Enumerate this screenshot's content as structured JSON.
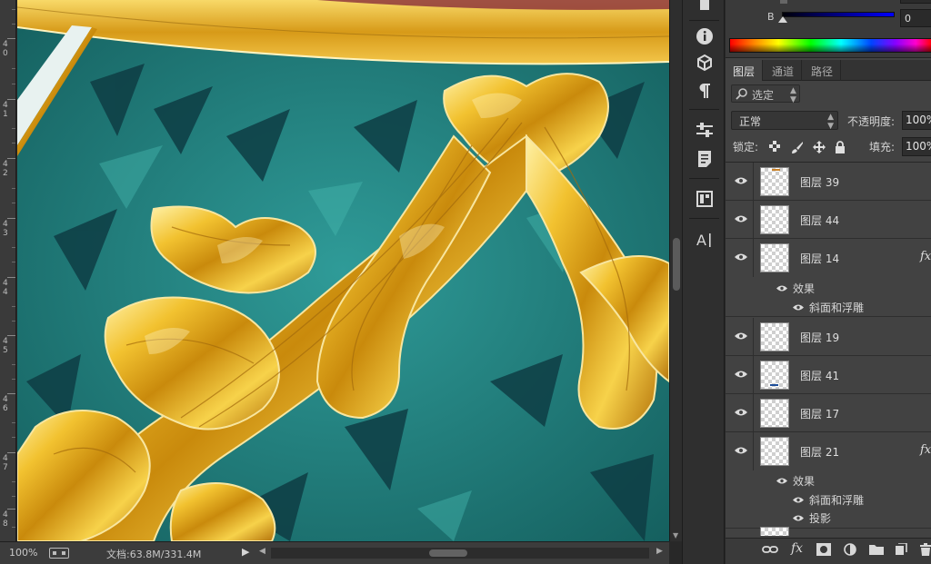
{
  "status": {
    "zoom": "100%",
    "doc_info": "文档:63.8M/331.4M"
  },
  "ruler": {
    "labels": [
      "4\n0",
      "4\n1",
      "4\n2",
      "4\n3",
      "4\n4",
      "4\n5",
      "4\n6",
      "4\n7",
      "4\n8"
    ]
  },
  "color_panel": {
    "channel_label": "B",
    "channel_value": "0"
  },
  "layers_panel": {
    "tabs": [
      "图层",
      "通道",
      "路径"
    ],
    "filter_label": "选定",
    "blend_mode": "正常",
    "opacity_label": "不透明度:",
    "opacity_value": "100%",
    "lock_label": "锁定:",
    "fill_label": "填充:",
    "fill_value": "100%",
    "effects_label": "效果",
    "layers": [
      {
        "name": "图层 39",
        "has_fx": false
      },
      {
        "name": "图层 44",
        "has_fx": false
      },
      {
        "name": "图层 14",
        "has_fx": true,
        "effects": [
          "斜面和浮雕"
        ]
      },
      {
        "name": "图层 19",
        "has_fx": false
      },
      {
        "name": "图层 41",
        "has_fx": false
      },
      {
        "name": "图层 17",
        "has_fx": false
      },
      {
        "name": "图层 21",
        "has_fx": true,
        "effects": [
          "斜面和浮雕",
          "投影"
        ]
      }
    ],
    "fx_glyph": "fx"
  },
  "icons": {
    "tools": [
      "info-icon",
      "3d-cube-icon",
      "paragraph-icon",
      "adjust-sliders-icon",
      "notes-icon",
      "navigator-icon",
      "character-icon"
    ],
    "footer": [
      "link-layers-icon",
      "fx-icon",
      "mask-icon",
      "adjustment-layer-icon",
      "new-group-icon",
      "new-layer-icon",
      "delete-icon"
    ]
  },
  "colors": {
    "canvas_teal": "#1f7a7a",
    "gold": "#e6a81c",
    "panel_bg": "#424242"
  }
}
